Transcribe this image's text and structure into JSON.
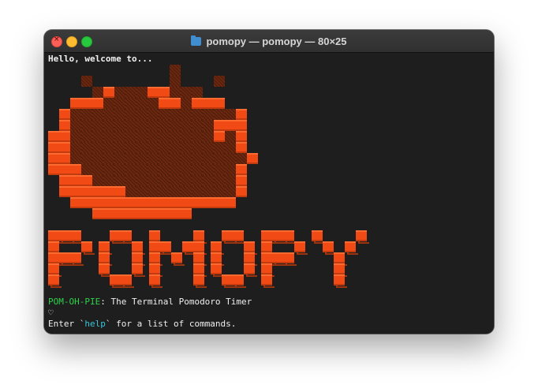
{
  "window": {
    "title": "pomopy — pomopy — 80×25",
    "folder_icon": "folder-icon",
    "buttons": [
      "close-button",
      "minimize-button",
      "maximize-button"
    ],
    "colors": {
      "close": "#fe5f57",
      "minimize": "#febc2e",
      "maximize": "#28c840",
      "background": "#1e1e1e",
      "accent_orange": "#f24a14",
      "green": "#2fd14a",
      "cyan": "#37c5dc"
    }
  },
  "terminal": {
    "greeting": "Hello, welcome to...",
    "app_name": "POM-OH-PIE",
    "tagline": ": The Terminal Pomodoro Timer",
    "heart": "♡",
    "help_prefix": "Enter `",
    "help_command": "help",
    "help_suffix": "` for a list of commands.",
    "tomato_art": "tomato-ascii-art",
    "logo_art": "POMOPY"
  }
}
